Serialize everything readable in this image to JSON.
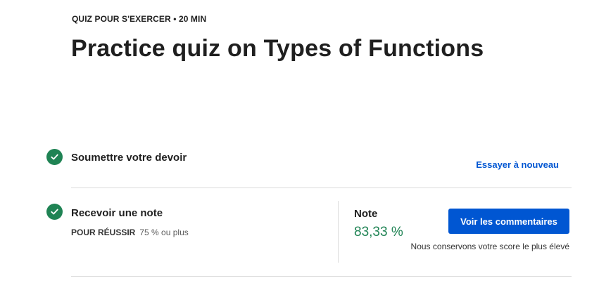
{
  "header": {
    "eyebrow": "QUIZ POUR S'EXERCER • 20  MIN",
    "title": "Practice quiz on Types of Functions"
  },
  "steps": [
    {
      "label": "Soumettre votre devoir",
      "status": "completed",
      "action_label": "Essayer à nouveau"
    },
    {
      "label": "Recevoir une note",
      "status": "completed",
      "pass_label": "POUR RÉUSSIR",
      "pass_value": "75 % ou plus"
    }
  ],
  "grade": {
    "label": "Note",
    "value": "83,33 %",
    "feedback_button": "Voir les commentaires",
    "note": "Nous conservons votre score le plus élevé"
  },
  "colors": {
    "success": "#1f8354",
    "primary": "#0056d2",
    "divider": "#dcdcdc"
  },
  "icons": {
    "step_status": "check-circle-icon"
  }
}
